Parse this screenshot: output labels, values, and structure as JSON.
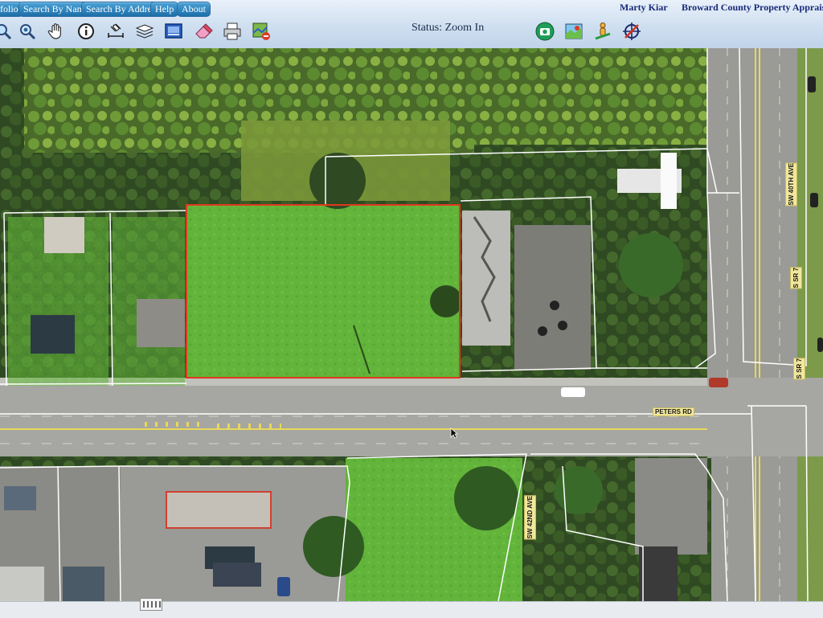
{
  "nav": {
    "portfolio_label": "folio",
    "search_name_label": "Search By Name",
    "search_address_label": "Search By Address",
    "help_label": "Help",
    "about_label": "About"
  },
  "header": {
    "appraiser_name": "Marty Kiar",
    "office_name": "Broward County Property Apprais"
  },
  "status": {
    "text": "Status: Zoom In"
  },
  "toolbar_icons": [
    "zoom-in-icon",
    "zoom-out-icon",
    "pan-icon",
    "identify-icon",
    "measure-icon",
    "layers-icon",
    "map-view-icon",
    "eraser-icon",
    "print-icon",
    "clear-selection-icon",
    "camera-icon",
    "aerial-map-icon",
    "street-view-icon",
    "crosshair-icon"
  ],
  "map": {
    "streets": {
      "sw40th": "SW 40TH AVE",
      "sr7_north": "S SR 7",
      "sr7_south": "S SR 7",
      "peters": "PETERS RD",
      "sw42nd": "SW 42ND AVE"
    },
    "selected_parcel_color": "#e0391e",
    "parcel_line_color": "#ffffff"
  }
}
